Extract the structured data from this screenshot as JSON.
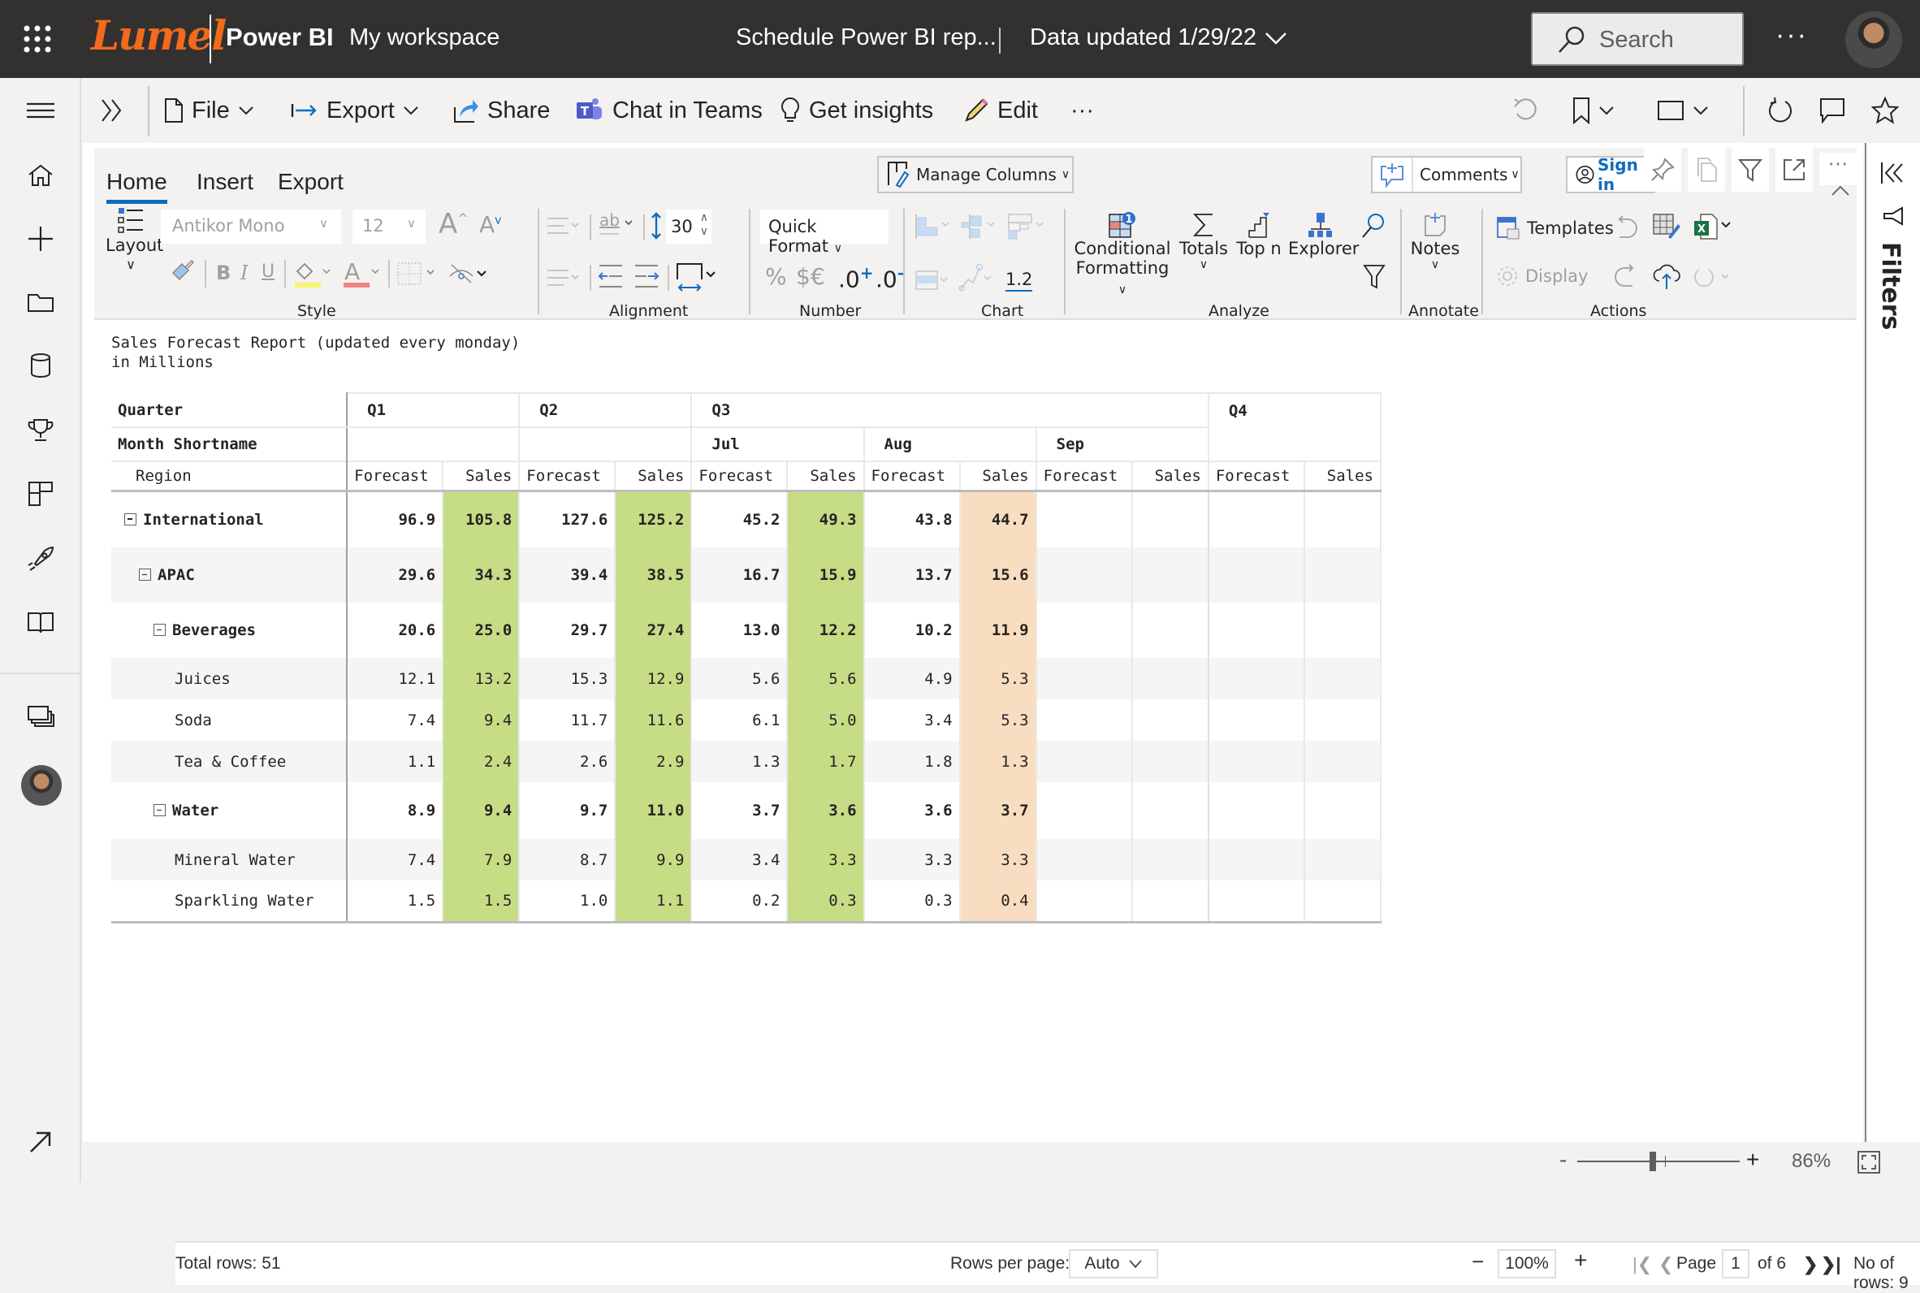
{
  "topbar": {
    "brand_logo": "Lumel",
    "app_name": "Power BI",
    "workspace": "My workspace",
    "report_title": "Schedule Power BI rep...",
    "data_updated": "Data updated 1/29/22",
    "search_placeholder": "Search",
    "more": "···"
  },
  "toolbar": {
    "file": "File",
    "export": "Export",
    "share": "Share",
    "chat_in_teams": "Chat in Teams",
    "get_insights": "Get insights",
    "edit": "Edit",
    "more": "···"
  },
  "ribbon": {
    "tabs": [
      "Home",
      "Insert",
      "Export"
    ],
    "active_tab": "Home",
    "manage_columns": "Manage Columns",
    "comments": "Comments",
    "sign_in": "Sign in",
    "layout": "Layout",
    "font_family": "Antikor Mono",
    "font_size": "12",
    "row_height": "30",
    "quick_format": "Quick Format",
    "number_percent": "%",
    "number_currency": "$€",
    "decimal_increase": ".0",
    "decimal_decrease": ".0",
    "chart_value": "1.2",
    "conditional_formatting_1": "Conditional",
    "conditional_formatting_2": "Formatting",
    "conditional_badge": "1",
    "totals": "Totals",
    "top_n": "Top n",
    "explorer": "Explorer",
    "notes": "Notes",
    "templates": "Templates",
    "display": "Display",
    "groups": {
      "style": "Style",
      "alignment": "Alignment",
      "number": "Number",
      "chart": "Chart",
      "analyze": "Analyze",
      "annotate": "Annotate",
      "actions": "Actions"
    }
  },
  "report": {
    "title_line1": "Sales Forecast Report (updated every monday)",
    "title_line2": "in Millions",
    "header": {
      "quarter_label": "Quarter",
      "month_label": "Month Shortname",
      "region_label": "Region",
      "quarters": [
        "Q1",
        "Q2",
        "Q3",
        "Q4"
      ],
      "months": [
        "Jul",
        "Aug",
        "Sep"
      ],
      "measures": [
        "Forecast",
        "Sales"
      ]
    },
    "colors": {
      "sales_green": "#c6dd86",
      "sales_peach": "#f9ddc0"
    },
    "rows": [
      {
        "label": "International",
        "level": 0,
        "bold": true,
        "expander": true,
        "values": [
          "96.9",
          "105.8",
          "127.6",
          "125.2",
          "45.2",
          "49.3",
          "43.8",
          "44.7",
          "",
          "",
          "",
          ""
        ]
      },
      {
        "label": "APAC",
        "level": 1,
        "bold": true,
        "expander": true,
        "values": [
          "29.6",
          "34.3",
          "39.4",
          "38.5",
          "16.7",
          "15.9",
          "13.7",
          "15.6",
          "",
          "",
          "",
          ""
        ]
      },
      {
        "label": "Beverages",
        "level": 2,
        "bold": true,
        "expander": true,
        "values": [
          "20.6",
          "25.0",
          "29.7",
          "27.4",
          "13.0",
          "12.2",
          "10.2",
          "11.9",
          "",
          "",
          "",
          ""
        ]
      },
      {
        "label": "Juices",
        "level": 3,
        "bold": false,
        "expander": false,
        "values": [
          "12.1",
          "13.2",
          "15.3",
          "12.9",
          "5.6",
          "5.6",
          "4.9",
          "5.3",
          "",
          "",
          "",
          ""
        ]
      },
      {
        "label": "Soda",
        "level": 3,
        "bold": false,
        "expander": false,
        "values": [
          "7.4",
          "9.4",
          "11.7",
          "11.6",
          "6.1",
          "5.0",
          "3.4",
          "5.3",
          "",
          "",
          "",
          ""
        ]
      },
      {
        "label": "Tea & Coffee",
        "level": 3,
        "bold": false,
        "expander": false,
        "values": [
          "1.1",
          "2.4",
          "2.6",
          "2.9",
          "1.3",
          "1.7",
          "1.8",
          "1.3",
          "",
          "",
          "",
          ""
        ]
      },
      {
        "label": "Water",
        "level": 2,
        "bold": true,
        "expander": true,
        "values": [
          "8.9",
          "9.4",
          "9.7",
          "11.0",
          "3.7",
          "3.6",
          "3.6",
          "3.7",
          "",
          "",
          "",
          ""
        ]
      },
      {
        "label": "Mineral Water",
        "level": 3,
        "bold": false,
        "expander": false,
        "values": [
          "7.4",
          "7.9",
          "8.7",
          "9.9",
          "3.4",
          "3.3",
          "3.3",
          "3.3",
          "",
          "",
          "",
          ""
        ]
      },
      {
        "label": "Sparkling Water",
        "level": 3,
        "bold": false,
        "expander": false,
        "values": [
          "1.5",
          "1.5",
          "1.0",
          "1.1",
          "0.2",
          "0.3",
          "0.3",
          "0.4",
          "",
          "",
          "",
          ""
        ]
      }
    ]
  },
  "footer": {
    "total_rows": "Total rows: 51",
    "rows_per_page_label": "Rows per page:",
    "rows_per_page_value": "Auto",
    "zoom_value": "100%",
    "page_label": "Page",
    "page_current": "1",
    "page_of": "of 6",
    "no_of_rows": "No of rows: 9"
  },
  "statusbar": {
    "zoom_percent": "86%",
    "zoom_fraction": 0.86
  },
  "filters": {
    "label": "Filters"
  }
}
